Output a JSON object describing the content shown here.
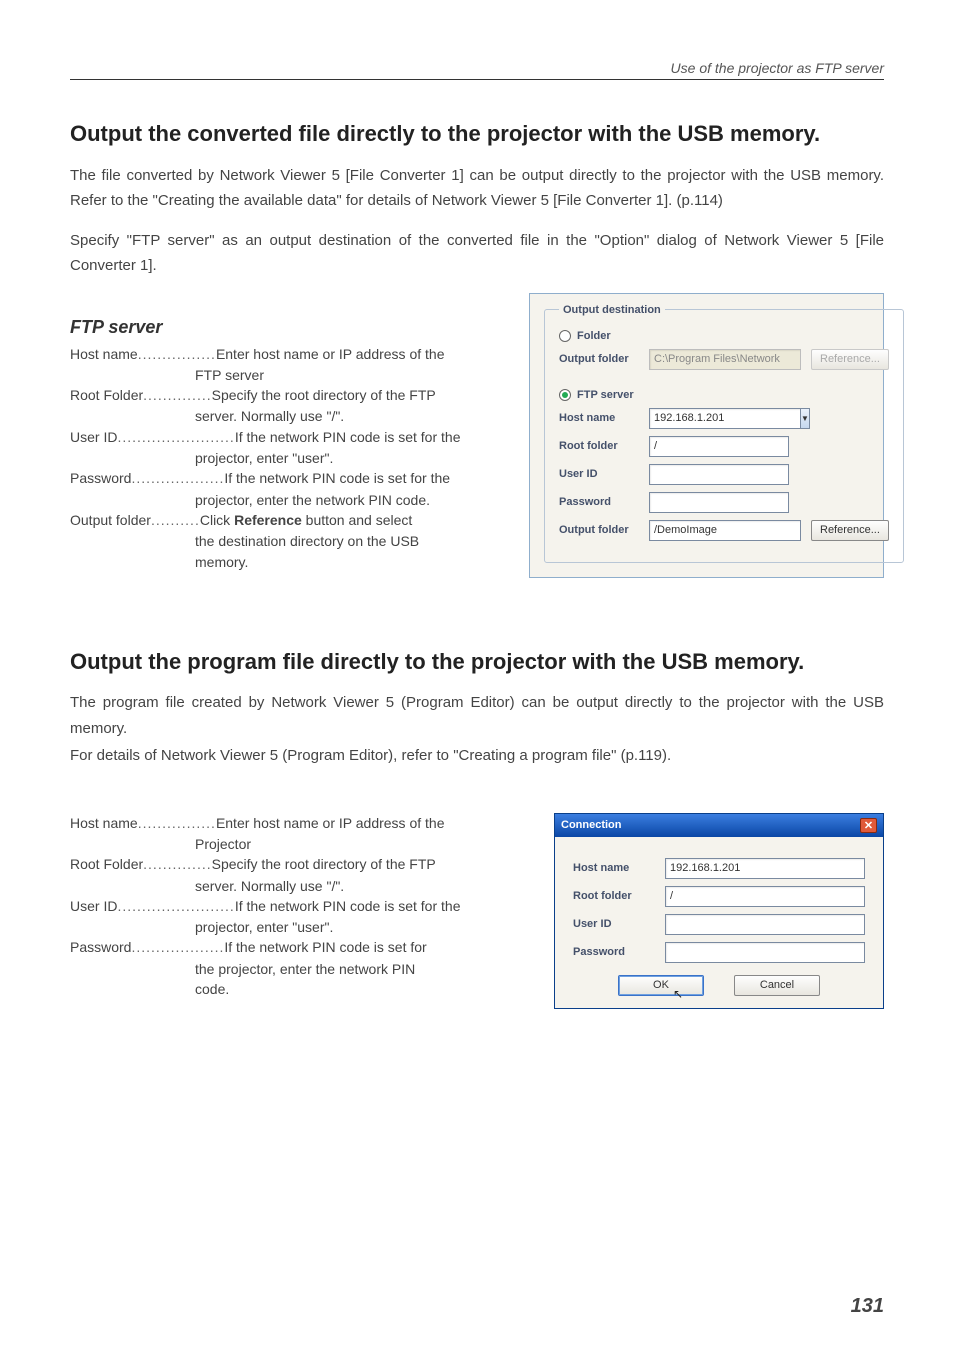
{
  "header": {
    "right": "Use of the projector as FTP server"
  },
  "section1": {
    "title": "Output the converted file directly to the projector with the USB memory.",
    "para1": "The file converted by Network Viewer 5 [File Converter 1] can be output directly to the projector with the USB memory. Refer to the \"Creating the available data\" for details of Network Viewer 5 [File Converter 1]. (p.114)",
    "para2": "Specify \"FTP server\" as an output destination of the converted file in the  \"Option\" dialog of Network Viewer 5 [File Converter 1]."
  },
  "ftpserver": {
    "heading": "FTP server",
    "defs": [
      {
        "term": "Host name",
        "dots": "................",
        "desc1": "Enter host name or IP address of the",
        "cont": "FTP server"
      },
      {
        "term": "Root Folder",
        "dots": "..............",
        "desc1": "Specify the root directory of the FTP",
        "cont": "server. Normally use \"/\"."
      },
      {
        "term": "User ID",
        "dots": "........................",
        "desc1": "If the network PIN code is set for the",
        "cont": "projector, enter \"user\"."
      },
      {
        "term": "Password",
        "dots": "...................",
        "desc1": "If the network PIN code is set for the",
        "cont": "projector, enter the network PIN code."
      },
      {
        "term": "Output folder",
        "dots": "..........",
        "desc1_pre": "Click ",
        "desc1_bold": "Reference",
        "desc1_post": " button and select",
        "cont": "the destination directory on the USB",
        "cont2": "memory."
      }
    ]
  },
  "dialog1": {
    "legend": "Output destination",
    "folder_radio": "Folder",
    "output_folder_label": "Output folder",
    "output_folder_value": "C:\\Program Files\\Network",
    "reference_btn": "Reference...",
    "ftp_radio": "FTP server",
    "host_label": "Host name",
    "host_value": "192.168.1.201",
    "root_label": "Root folder",
    "root_value": "/",
    "userid_label": "User ID",
    "userid_value": "",
    "password_label": "Password",
    "password_value": "",
    "out_label": "Output folder",
    "out_value": "/DemoImage",
    "reference_btn2": "Reference..."
  },
  "section2": {
    "title": "Output the program file directly to the projector with the USB memory.",
    "para1": "The program file created by Network Viewer 5 (Program Editor) can be output directly to the projector with the USB memory.",
    "para2": "For details of Network Viewer 5 (Program Editor), refer to \"Creating a program file\" (p.119)."
  },
  "defs2": [
    {
      "term": "Host name",
      "dots": "................",
      "desc1": "Enter host name or IP address of the",
      "cont": "Projector"
    },
    {
      "term": "Root Folder",
      "dots": "..............",
      "desc1": "Specify the root directory of the FTP",
      "cont": "server. Normally use \"/\"."
    },
    {
      "term": "User ID",
      "dots": "........................",
      "desc1": "If the network PIN code is set for the",
      "cont": "projector, enter \"user\"."
    },
    {
      "term": "Password",
      "dots": "...................",
      "desc1": "If the network PIN code is set for",
      "cont": "the projector, enter the network PIN",
      "cont2": "code."
    }
  ],
  "dialog2": {
    "title": "Connection",
    "host_label": "Host name",
    "host_value": "192.168.1.201",
    "root_label": "Root folder",
    "root_value": "/",
    "userid_label": "User ID",
    "userid_value": "",
    "password_label": "Password",
    "password_value": "",
    "ok": "OK",
    "cancel": "Cancel"
  },
  "page": "131"
}
